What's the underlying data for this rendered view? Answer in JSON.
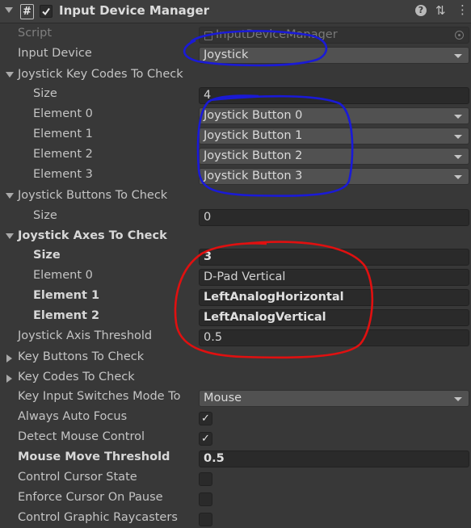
{
  "component": {
    "title": "Input Device Manager",
    "script_icon_glyph": "#",
    "enabled": true
  },
  "fields": {
    "script": {
      "label": "Script",
      "value": "InputDeviceManager"
    },
    "input_device": {
      "label": "Input Device",
      "value": "Joystick"
    },
    "joystick_key_codes": {
      "label": "Joystick Key Codes To Check",
      "size_label": "Size",
      "size": "4",
      "elements": [
        {
          "label": "Element 0",
          "value": "Joystick Button 0"
        },
        {
          "label": "Element 1",
          "value": "Joystick Button 1"
        },
        {
          "label": "Element 2",
          "value": "Joystick Button 2"
        },
        {
          "label": "Element 3",
          "value": "Joystick Button 3"
        }
      ]
    },
    "joystick_buttons": {
      "label": "Joystick Buttons To Check",
      "size_label": "Size",
      "size": "0"
    },
    "joystick_axes": {
      "label": "Joystick Axes To Check",
      "size_label": "Size",
      "size": "3",
      "elements": [
        {
          "label": "Element 0",
          "value": "D-Pad Vertical"
        },
        {
          "label": "Element 1",
          "value": "LeftAnalogHorizontal"
        },
        {
          "label": "Element 2",
          "value": "LeftAnalogVertical"
        }
      ]
    },
    "axis_threshold": {
      "label": "Joystick Axis Threshold",
      "value": "0.5"
    },
    "key_buttons": {
      "label": "Key Buttons To Check"
    },
    "key_codes": {
      "label": "Key Codes To Check"
    },
    "key_input_switch": {
      "label": "Key Input Switches Mode To",
      "value": "Mouse"
    },
    "always_auto_focus": {
      "label": "Always Auto Focus",
      "checked": true
    },
    "detect_mouse_control": {
      "label": "Detect Mouse Control",
      "checked": true
    },
    "mouse_move_threshold": {
      "label": "Mouse Move Threshold",
      "value": "0.5"
    },
    "control_cursor_state": {
      "label": "Control Cursor State",
      "checked": false
    },
    "enforce_cursor_on_pause": {
      "label": "Enforce Cursor On Pause",
      "checked": false
    },
    "control_graphic_raycasters": {
      "label": "Control Graphic Raycasters",
      "checked": false
    }
  },
  "glyphs": {
    "check": "✓",
    "help": "?",
    "sliders": "⇅",
    "more": "⋮"
  },
  "annotation_colors": {
    "blue": "#1a1ad6",
    "red": "#e01010"
  }
}
